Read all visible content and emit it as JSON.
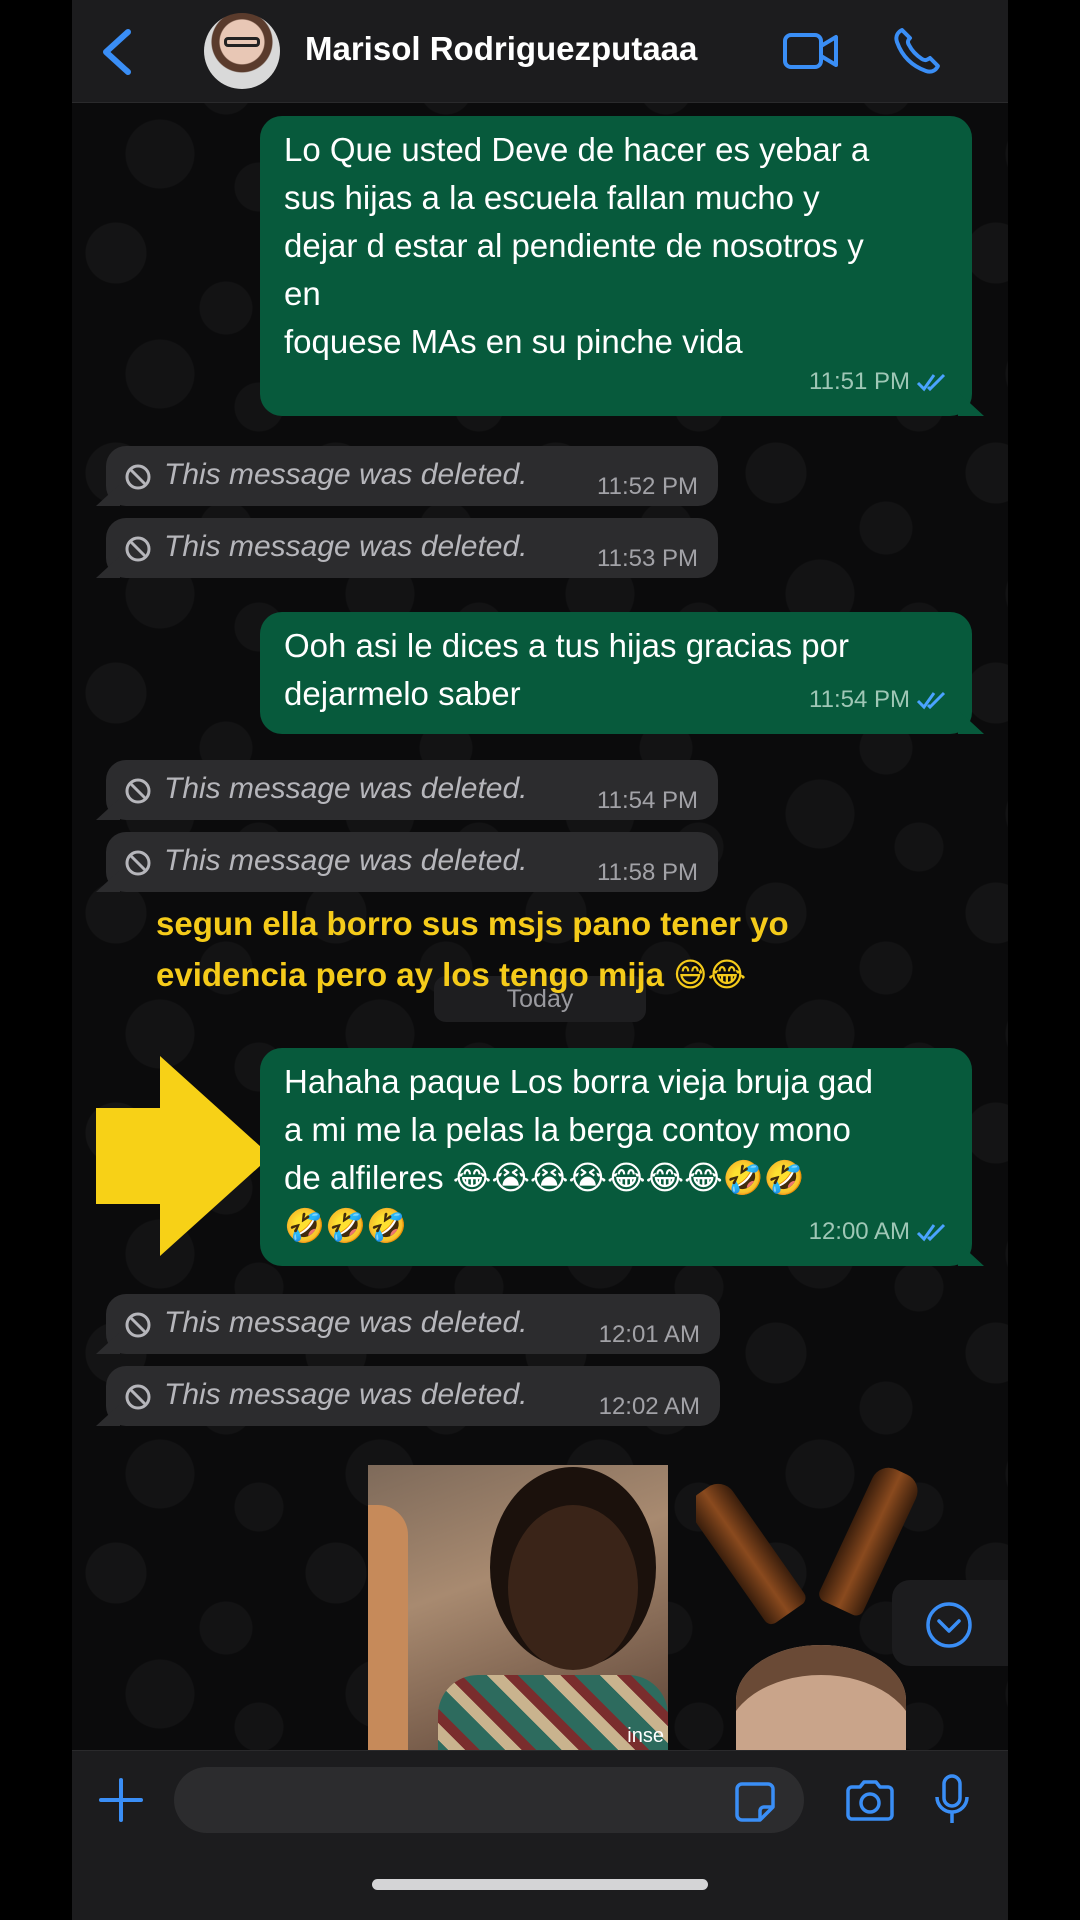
{
  "header": {
    "contact_name": "Marisol Rodriguezputaaa",
    "back_icon": "chevron-left-icon",
    "video_icon": "video-camera-icon",
    "call_icon": "phone-icon"
  },
  "messages": [
    {
      "type": "outgoing",
      "text": "Lo Que usted Deve de hacer es yebar a\nsus hijas a la escuela fallan mucho y\ndejar d estar al pendiente de nosotros y\nen\nfoquese MAs en su pinche vida",
      "time": "11:51 PM",
      "status": "read"
    },
    {
      "type": "deleted",
      "text": "This message was deleted.",
      "time": "11:52 PM"
    },
    {
      "type": "deleted",
      "text": "This message was deleted.",
      "time": "11:53 PM"
    },
    {
      "type": "outgoing",
      "text": "Ooh asi le dices a tus hijas gracias por\ndejarmelo saber",
      "time": "11:54 PM",
      "status": "read"
    },
    {
      "type": "deleted",
      "text": "This message was deleted.",
      "time": "11:54 PM"
    },
    {
      "type": "deleted",
      "text": "This message was deleted.",
      "time": "11:58 PM"
    },
    {
      "type": "outgoing",
      "text": "Hahaha paque Los borra vieja bruja gad\na mi me la pelas la berga contoy mono\nde alfileres 😂😭😭😭😂😂😂🤣🤣\n🤣🤣🤣",
      "time": "12:00 AM",
      "status": "read"
    },
    {
      "type": "deleted",
      "text": "This message was deleted.",
      "time": "12:01 AM"
    },
    {
      "type": "deleted",
      "text": "This message was deleted.",
      "time": "12:02 AM"
    }
  ],
  "date_separator": "Today",
  "annotation": "segun ella borro sus msjs pano tener yo\nevidencia pero ay los tengo mija 😅😂",
  "media": [
    {
      "kind": "gif",
      "watermark": "inse"
    },
    {
      "kind": "gif",
      "watermark": ""
    }
  ],
  "composer": {
    "placeholder": "",
    "plus_icon": "plus-icon",
    "sticker_icon": "sticker-icon",
    "camera_icon": "camera-icon",
    "mic_icon": "microphone-icon"
  },
  "colors": {
    "accent": "#3a8ef6",
    "outgoing_bubble": "#075a3c",
    "deleted_bubble": "#2c2c2e",
    "annotation": "#f5cb1a",
    "arrow": "#f7d117"
  }
}
